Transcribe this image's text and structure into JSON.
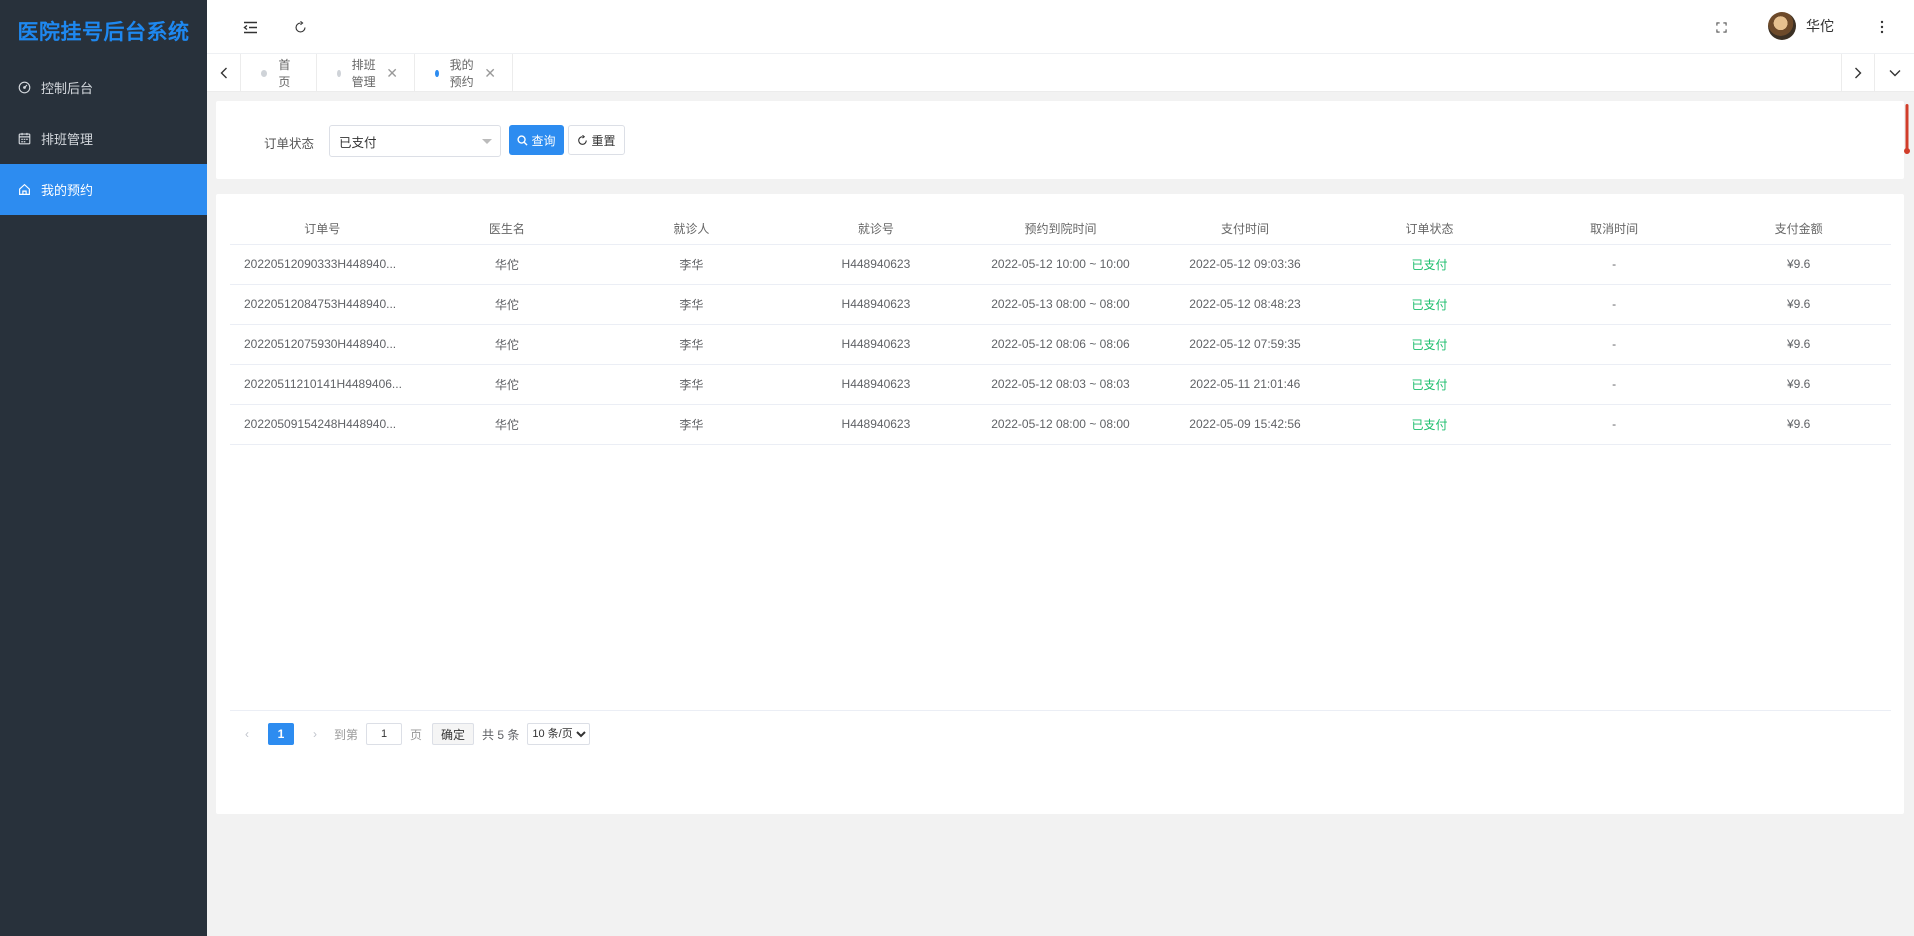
{
  "app": {
    "title": "医院挂号后台系统",
    "accent": "#2d8cf0",
    "sidebar_bg": "#28313b"
  },
  "sidebar": {
    "items": [
      {
        "label": "控制后台",
        "icon": "dashboard-icon",
        "active": false
      },
      {
        "label": "排班管理",
        "icon": "calendar-icon",
        "active": false
      },
      {
        "label": "我的预约",
        "icon": "home-icon",
        "active": true
      }
    ]
  },
  "header": {
    "username": "华佗"
  },
  "tabs": [
    {
      "label": "首页",
      "closable": false,
      "active": false
    },
    {
      "label": "排班管理",
      "closable": true,
      "active": false
    },
    {
      "label": "我的预约",
      "closable": true,
      "active": true
    }
  ],
  "search": {
    "status_label": "订单状态",
    "status_value": "已支付",
    "query_label": "查询",
    "reset_label": "重置"
  },
  "table": {
    "columns": [
      "订单号",
      "医生名",
      "就诊人",
      "就诊号",
      "预约到院时间",
      "支付时间",
      "订单状态",
      "取消时间",
      "支付金额"
    ],
    "rows": [
      [
        "20220512090333H448940...",
        "华佗",
        "李华",
        "H448940623",
        "2022-05-12 10:00 ~ 10:00",
        "2022-05-12 09:03:36",
        "已支付",
        "-",
        "¥9.6"
      ],
      [
        "20220512084753H448940...",
        "华佗",
        "李华",
        "H448940623",
        "2022-05-13 08:00 ~ 08:00",
        "2022-05-12 08:48:23",
        "已支付",
        "-",
        "¥9.6"
      ],
      [
        "20220512075930H448940...",
        "华佗",
        "李华",
        "H448940623",
        "2022-05-12 08:06 ~ 08:06",
        "2022-05-12 07:59:35",
        "已支付",
        "-",
        "¥9.6"
      ],
      [
        "20220511210141H4489406...",
        "华佗",
        "李华",
        "H448940623",
        "2022-05-12 08:03 ~ 08:03",
        "2022-05-11 21:01:46",
        "已支付",
        "-",
        "¥9.6"
      ],
      [
        "20220509154248H448940...",
        "华佗",
        "李华",
        "H448940623",
        "2022-05-12 08:00 ~ 08:00",
        "2022-05-09 15:42:56",
        "已支付",
        "-",
        "¥9.6"
      ]
    ]
  },
  "pagination": {
    "current_page": "1",
    "goto_label": "到第",
    "goto_value": "1",
    "page_unit": "页",
    "confirm_label": "确定",
    "total_text": "共 5 条",
    "page_size": "10 条/页"
  }
}
